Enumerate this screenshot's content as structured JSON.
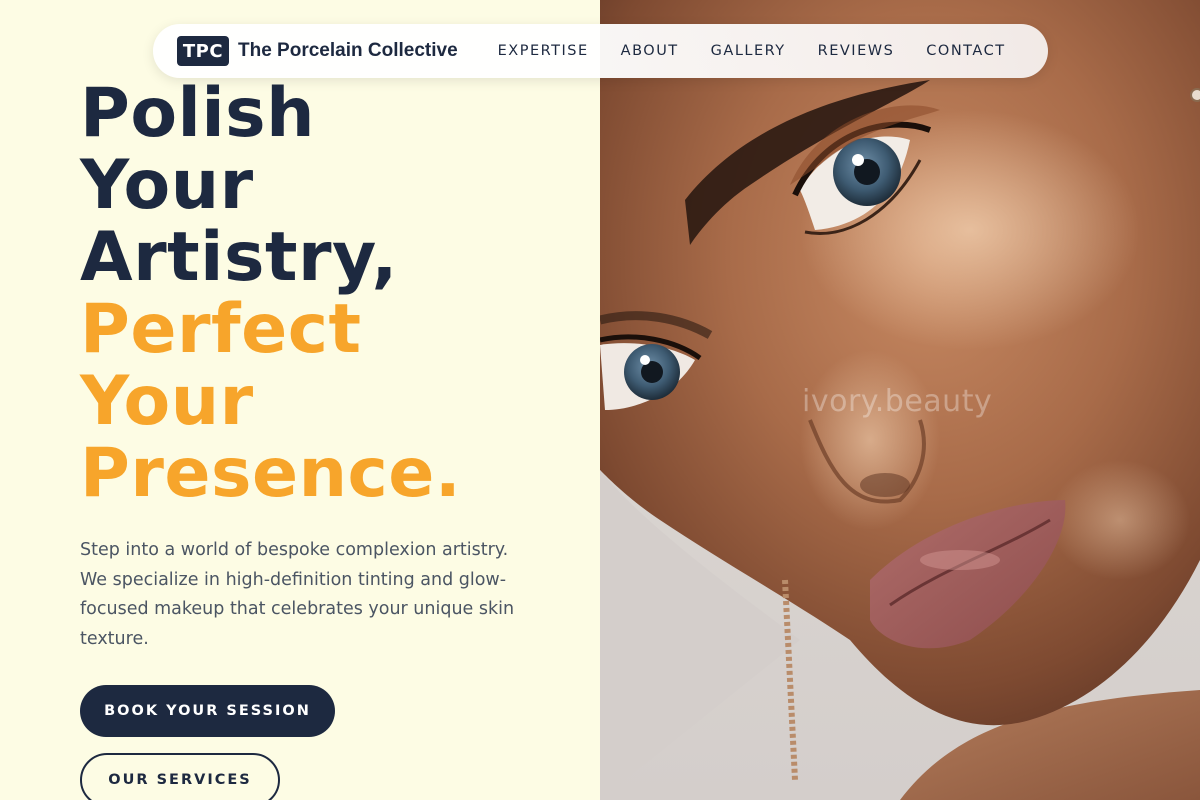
{
  "nav": {
    "logo_text": "TPC",
    "brand_name": "The Porcelain Collective",
    "links": [
      "EXPERTISE",
      "ABOUT",
      "GALLERY",
      "REVIEWS",
      "CONTACT"
    ]
  },
  "hero": {
    "headline_dark": [
      "Polish",
      "Your",
      "Artistry,"
    ],
    "headline_accent": [
      "Perfect",
      "Your",
      "Presence."
    ],
    "intro": "Step into a world of bespoke complexion artistry. We specialize in high-definition tinting and glow-focused makeup that celebrates your unique skin texture.",
    "primary_button": "BOOK YOUR SESSION",
    "secondary_button": "OUR SERVICES"
  },
  "photo": {
    "watermark": "ivory.beauty"
  },
  "colors": {
    "navy": "#1d2940",
    "accent": "#f7a52b",
    "background": "#fdfce4",
    "body_text": "#4b5563"
  }
}
